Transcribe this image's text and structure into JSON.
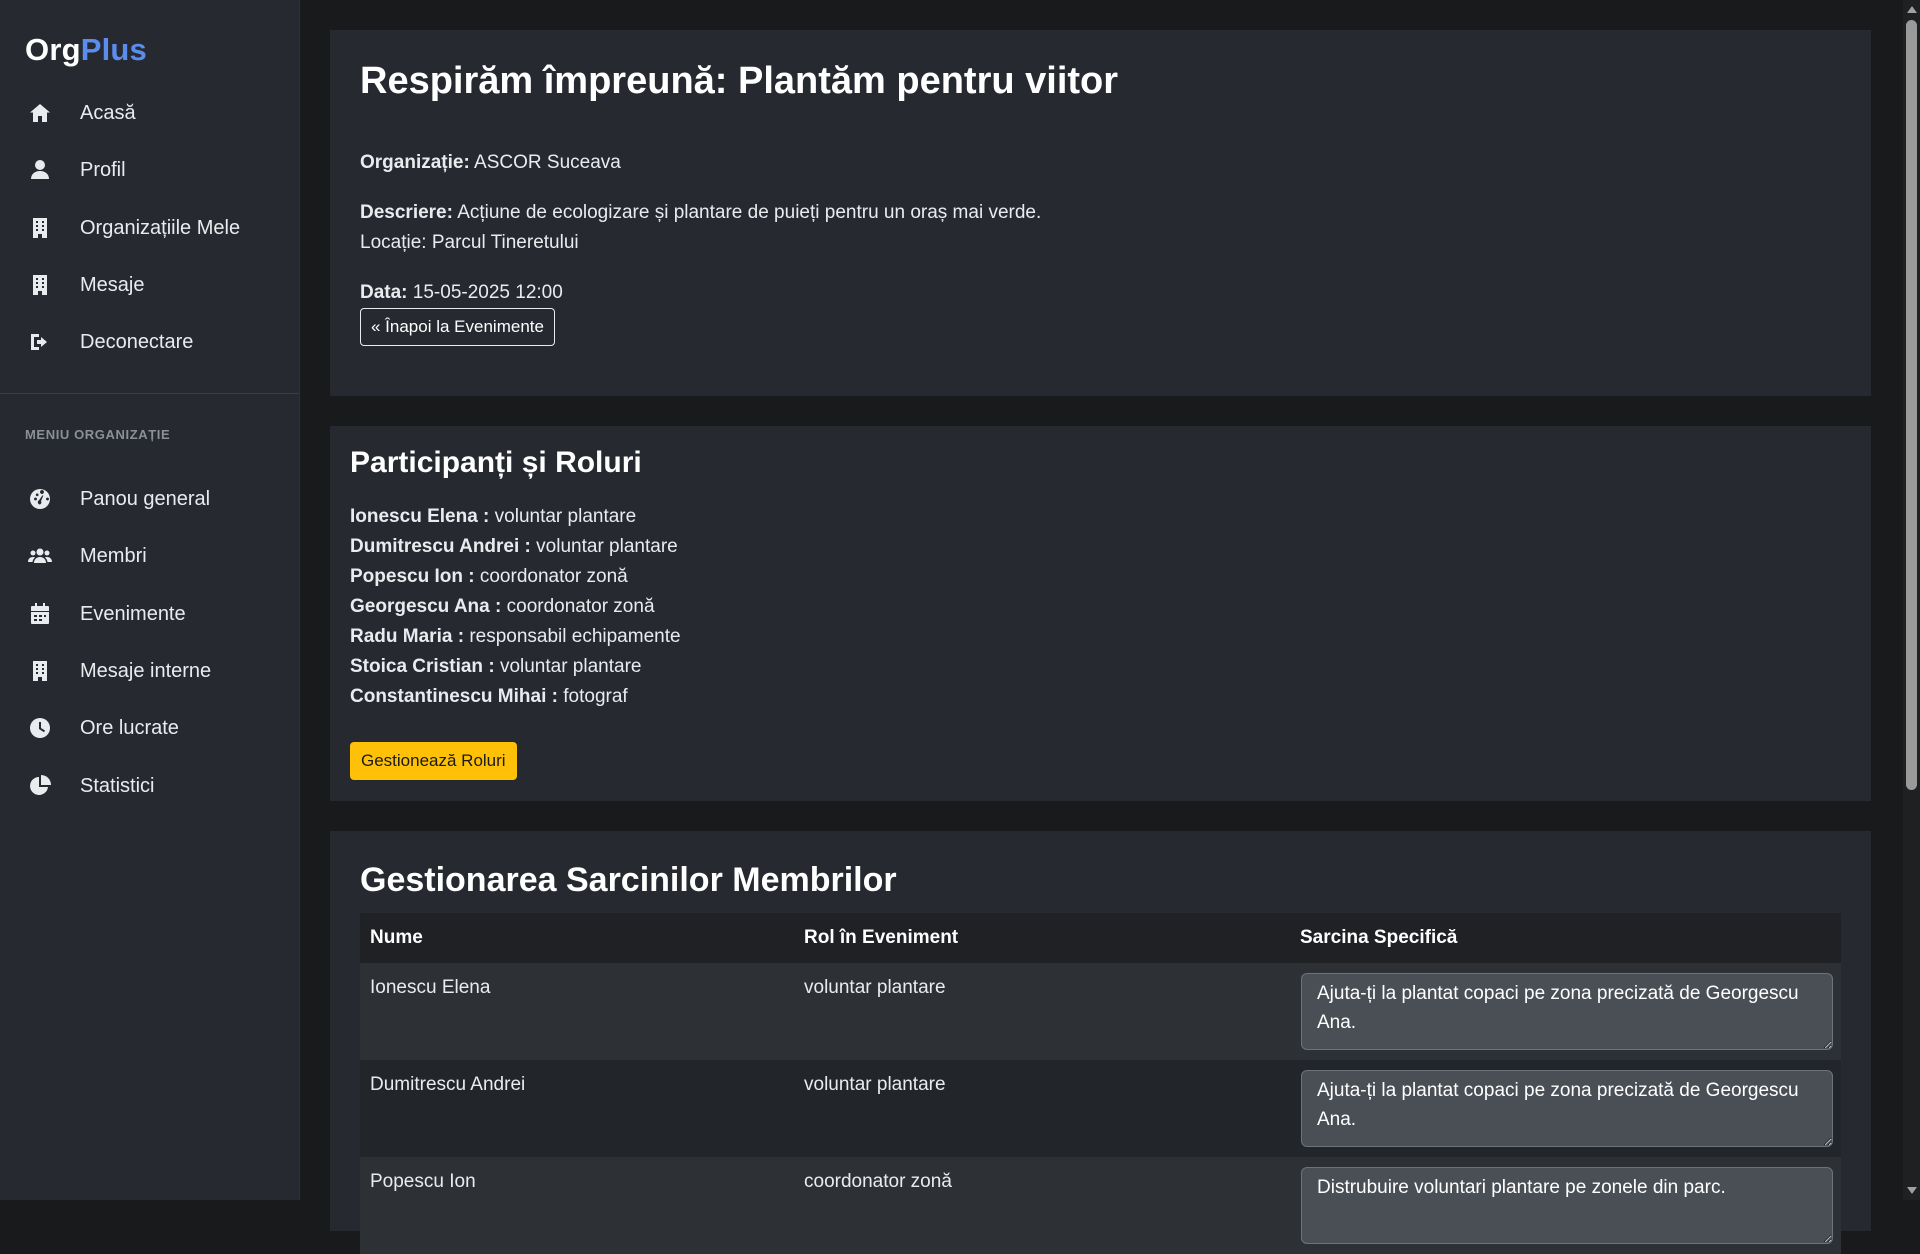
{
  "brand": {
    "org": "Org",
    "plus": "Plus"
  },
  "sidebar": {
    "items": [
      {
        "label": "Acasă",
        "icon": "home-icon"
      },
      {
        "label": "Profil",
        "icon": "user-icon"
      },
      {
        "label": "Organizațiile Mele",
        "icon": "building-icon"
      },
      {
        "label": "Mesaje",
        "icon": "building-icon"
      },
      {
        "label": "Deconectare",
        "icon": "sign-out-icon"
      }
    ],
    "section_label": "MENIU ORGANIZAȚIE",
    "org_items": [
      {
        "label": "Panou general",
        "icon": "gauge-icon"
      },
      {
        "label": "Membri",
        "icon": "users-icon"
      },
      {
        "label": "Evenimente",
        "icon": "calendar-icon"
      },
      {
        "label": "Mesaje interne",
        "icon": "building-icon"
      },
      {
        "label": "Ore lucrate",
        "icon": "clock-icon"
      },
      {
        "label": "Statistici",
        "icon": "pie-chart-icon"
      }
    ]
  },
  "event": {
    "title": "Respirăm împreună: Plantăm pentru viitor",
    "org_label": "Organizație:",
    "org_value": "ASCOR Suceava",
    "desc_label": "Descriere:",
    "desc_value": "Acțiune de ecologizare și plantare de puieți pentru un oraș mai verde.",
    "location": "Locație: Parcul Tineretului",
    "date_label": "Data:",
    "date_value": "15-05-2025 12:00",
    "back_button": "« Înapoi la Evenimente"
  },
  "participants": {
    "title": "Participanți și Roluri",
    "list": [
      {
        "name": "Ionescu Elena :",
        "role": "voluntar plantare"
      },
      {
        "name": "Dumitrescu Andrei :",
        "role": "voluntar plantare"
      },
      {
        "name": "Popescu Ion :",
        "role": "coordonator zonă"
      },
      {
        "name": "Georgescu Ana :",
        "role": "coordonator zonă"
      },
      {
        "name": "Radu Maria :",
        "role": "responsabil echipamente"
      },
      {
        "name": "Stoica Cristian :",
        "role": "voluntar plantare"
      },
      {
        "name": "Constantinescu Mihai :",
        "role": "fotograf"
      }
    ],
    "manage_button": "Gestionează Roluri"
  },
  "tasks": {
    "title": "Gestionarea Sarcinilor Membrilor",
    "headers": [
      "Nume",
      "Rol în Eveniment",
      "Sarcina Specifică"
    ],
    "rows": [
      {
        "name": "Ionescu Elena",
        "role": "voluntar plantare",
        "task": "Ajuta-ți la plantat copaci pe zona precizată de Georgescu Ana."
      },
      {
        "name": "Dumitrescu Andrei",
        "role": "voluntar plantare",
        "task": "Ajuta-ți la plantat copaci pe zona precizată de Georgescu Ana."
      },
      {
        "name": "Popescu Ion",
        "role": "coordonator zonă",
        "task": "Distrubuire voluntari plantare pe zonele din parc."
      }
    ]
  }
}
